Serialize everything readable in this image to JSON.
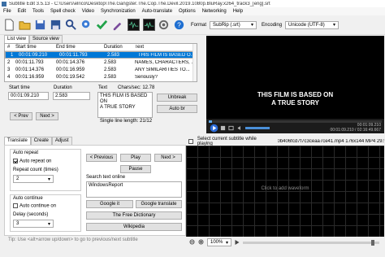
{
  "titlebar": {
    "title": "Subtitle Edit 3.5.13 - C:\\Users\\elrico\\Desktop\\The.Gangster.The.Cop.The.Devil.2019.1080p.BluRay.x264_track3_[eng].srt"
  },
  "menu": [
    "File",
    "Edit",
    "Tools",
    "Spell check",
    "Video",
    "Synchronization",
    "Auto-translate",
    "Options",
    "Networking",
    "Help"
  ],
  "toolbar": {
    "icons": [
      "new-file-icon",
      "open-folder-icon",
      "save-icon",
      "save-as-icon",
      "find-icon",
      "replace-icon",
      "fix-errors-icon",
      "remove-text-icon",
      "visual-sync-icon",
      "spell-check-icon",
      "settings-icon",
      "help-icon"
    ],
    "format_label": "Format",
    "format_value": "SubRip (.srt)",
    "encoding_label": "Encoding",
    "encoding_value": "Unicode (UTF-8)"
  },
  "view_tabs": [
    "List view",
    "Source view"
  ],
  "subtitle_list": {
    "columns": [
      "#",
      "Start time",
      "End time",
      "Duration",
      "Text"
    ],
    "rows": [
      {
        "num": "1",
        "start": "00:01:09.210",
        "end": "00:01:11.793",
        "duration": "2.583",
        "text": "THIS FILM IS BASED O..."
      },
      {
        "num": "2",
        "start": "00:01:11.793",
        "end": "00:01:14.376",
        "duration": "2.583",
        "text": "NAMES, CHARACTERS, ..."
      },
      {
        "num": "3",
        "start": "00:01:14.376",
        "end": "00:01:16.959",
        "duration": "2.583",
        "text": "ANY SIMILARITIES TO..."
      },
      {
        "num": "4",
        "start": "00:01:16.959",
        "end": "00:01:19.542",
        "duration": "2.583",
        "text": "Seriously?"
      }
    ],
    "selected_index": 0
  },
  "editor": {
    "start_time_label": "Start time",
    "start_time_value": "00:01:09.210",
    "duration_label": "Duration",
    "duration_value": "2.583",
    "text_label": "Text",
    "chars_sec": "Chars/sec: 12.78",
    "text_lines": [
      "THIS FILM IS BASED",
      "ON",
      "A TRUE STORY"
    ],
    "single_line_length": "Single line length: 21/12",
    "prev_label": "< Prev",
    "next_label": "Next >",
    "unbreak_label": "Unbreak",
    "auto_br_label": "Auto br"
  },
  "video": {
    "subtitle_lines": [
      "THIS FILM IS BASED ON",
      "A TRUE STORY"
    ],
    "time_display": "00:01:09.210",
    "total_time": "00:01:09.210 / 02:16:49.667"
  },
  "bottom_tabs": [
    "Translate",
    "Create",
    "Adjust"
  ],
  "translate": {
    "auto_repeat_title": "Auto repeat",
    "auto_repeat_on": "Auto repeat on",
    "repeat_count_label": "Repeat count (times)",
    "repeat_count_value": "2",
    "auto_continue_title": "Auto continue",
    "auto_continue_on": "Auto continue on",
    "delay_label": "Delay (seconds)",
    "delay_value": "3",
    "previous_label": "< Previous",
    "play_label": "Play",
    "next_label": "Next >",
    "pause_label": "Pause",
    "search_label": "Search text online",
    "search_value": "WindowsReport",
    "google_it_label": "Google it",
    "google_translate_label": "Google translate",
    "free_dictionary_label": "The Free Dictionary",
    "wikipedia_label": "Wikipedia",
    "tip": "Tip: Use <alt+arrow up/down> to go to previous/next subtitle"
  },
  "waveform": {
    "select_current_label": "Select current subtitle while playing",
    "file_info": "0b406fcd7f7c3ceaa7ce41.mp4 176x144 MP4 29.97",
    "click_msg": "Click to add waveform",
    "zoom_value": "100%"
  }
}
